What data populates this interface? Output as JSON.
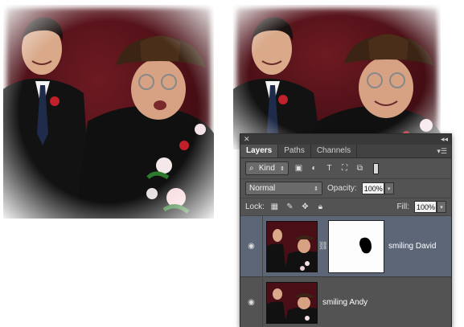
{
  "panel": {
    "titlebar": {
      "close_glyph": "✕",
      "collapse_glyph": "◂◂"
    },
    "tabs": [
      {
        "label": "Layers",
        "active": true
      },
      {
        "label": "Paths",
        "active": false
      },
      {
        "label": "Channels",
        "active": false
      }
    ],
    "menu_icon": "panel-menu-icon",
    "filter": {
      "kind_label": "Kind",
      "filter_icons": [
        "pixel-filter-icon",
        "adjustment-filter-icon",
        "type-filter-icon",
        "shape-filter-icon",
        "smart-object-filter-icon"
      ]
    },
    "blend": {
      "mode": "Normal",
      "opacity_label": "Opacity:",
      "opacity_value": "100%"
    },
    "lock": {
      "label": "Lock:",
      "fill_label": "Fill:",
      "fill_value": "100%",
      "lock_icons": [
        "lock-transparent-icon",
        "lock-image-icon",
        "lock-position-icon",
        "lock-all-icon"
      ]
    },
    "layers": [
      {
        "name": "smiling David",
        "selected": true,
        "has_mask": true
      },
      {
        "name": "smiling Andy",
        "selected": false,
        "has_mask": false
      }
    ]
  },
  "colors": {
    "panel_bg": "#535353",
    "selected_row": "#5c6677",
    "photo_bg": "#4a0f16"
  }
}
